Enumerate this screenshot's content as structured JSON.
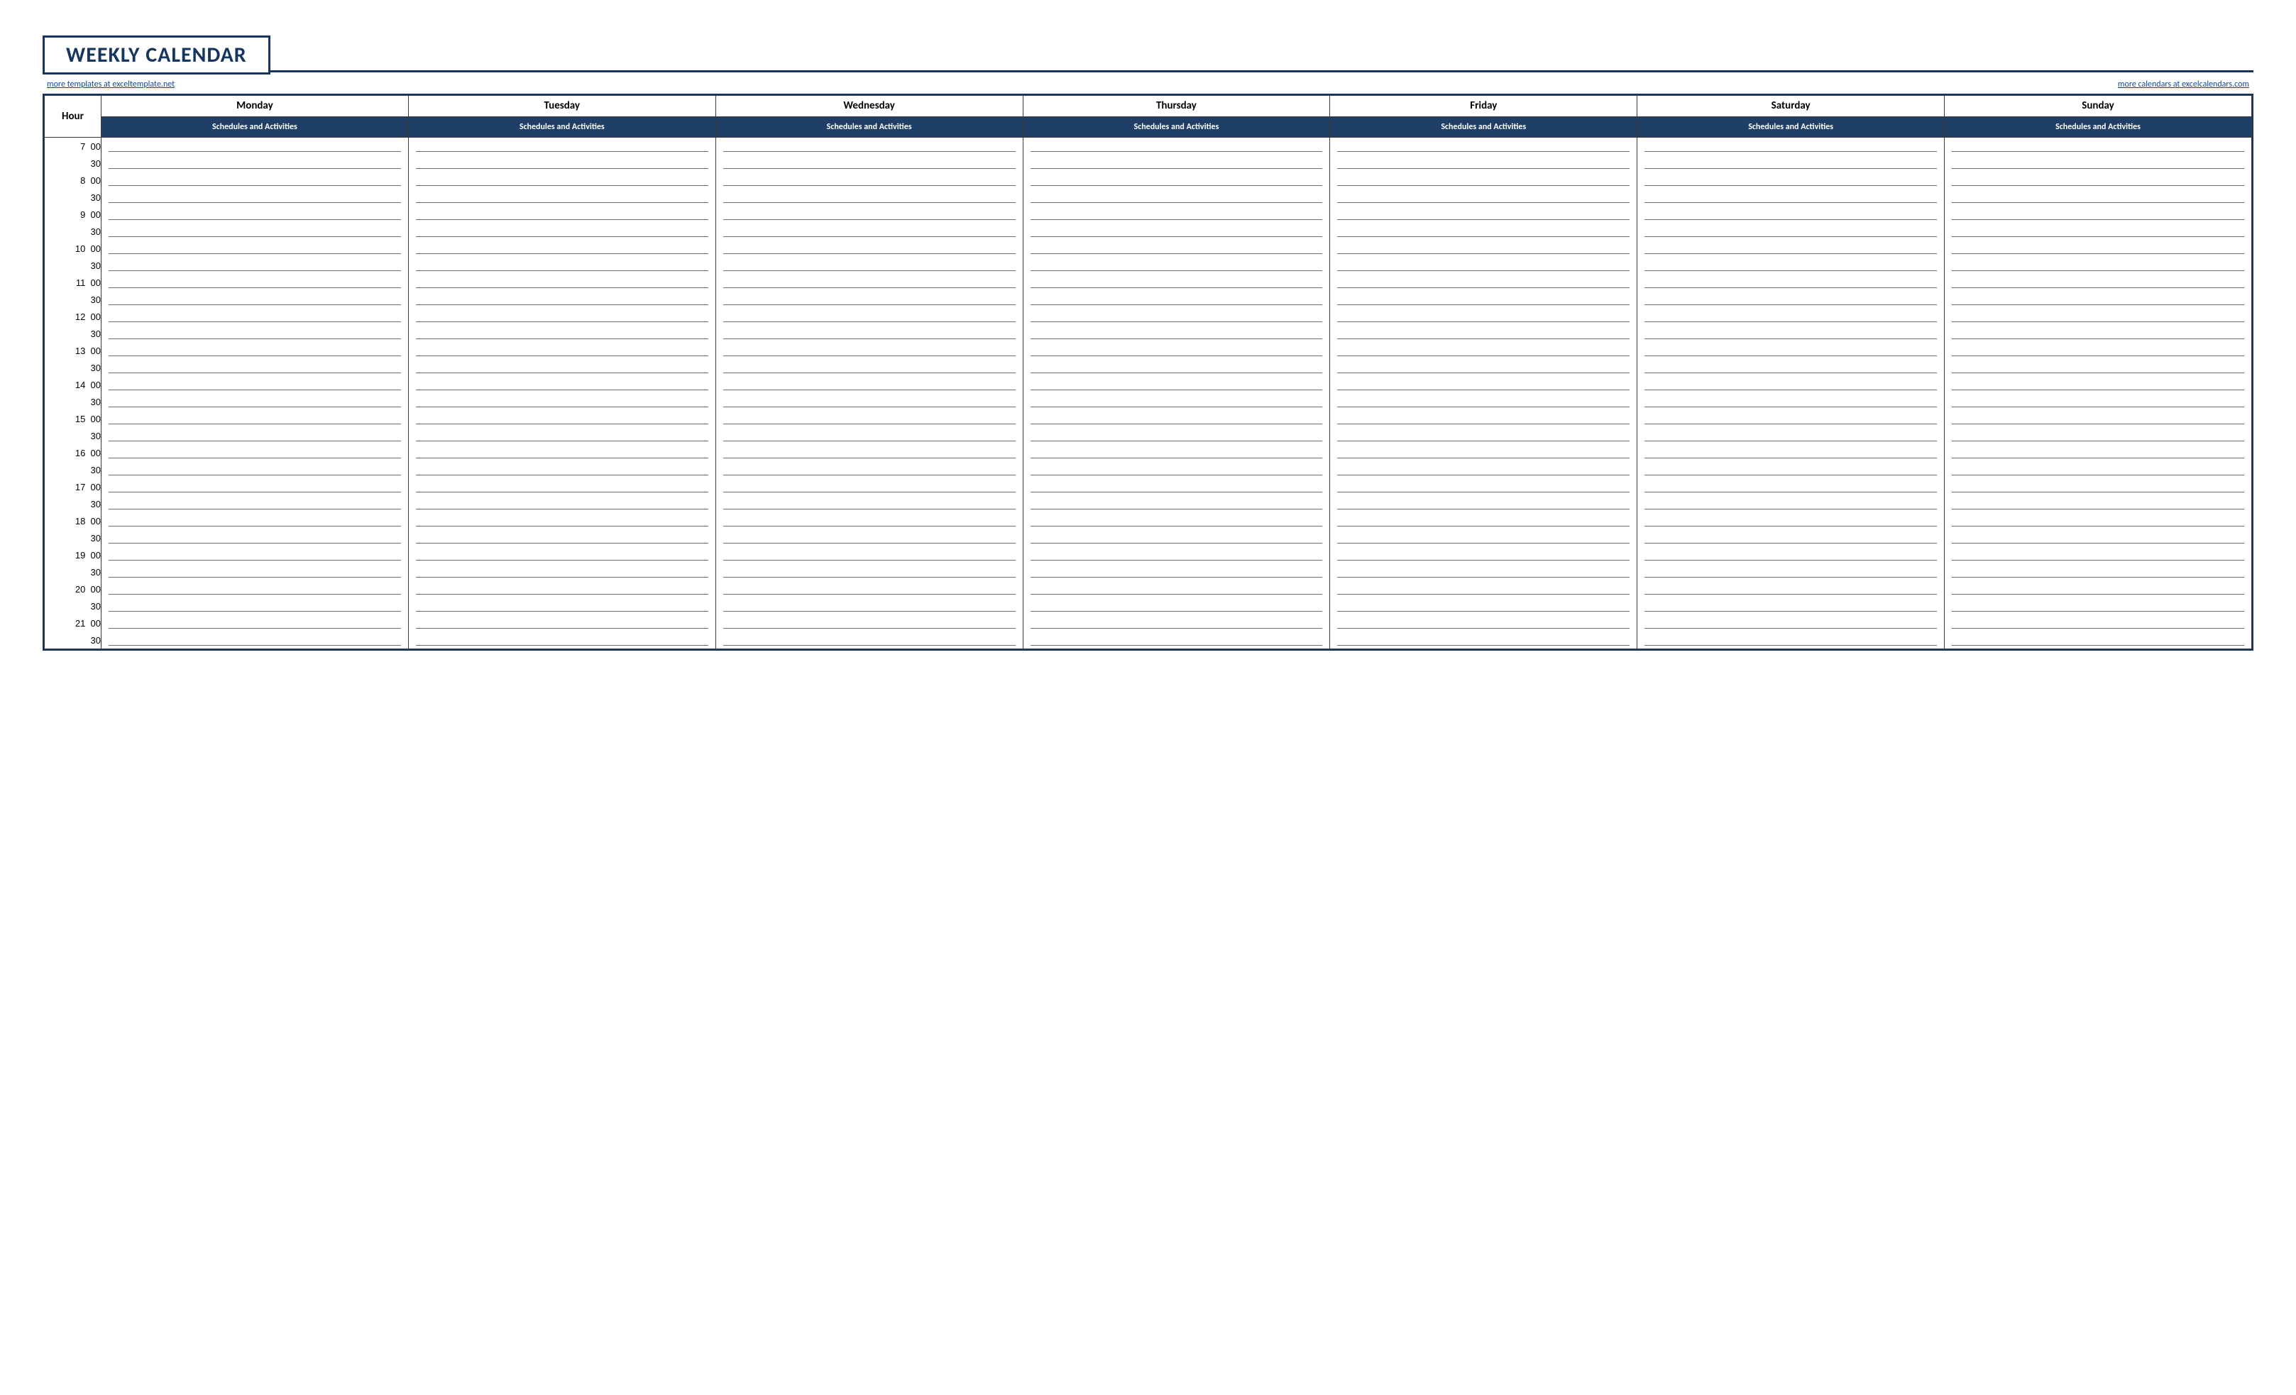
{
  "title": "WEEKLY CALENDAR",
  "links": {
    "left": "more templates at exceltemplate.net",
    "right": "more calendars at excelcalendars.com"
  },
  "hourLabel": "Hour",
  "days": [
    "Monday",
    "Tuesday",
    "Wednesday",
    "Thursday",
    "Friday",
    "Saturday",
    "Sunday"
  ],
  "subHeader": "Schedules and Activities",
  "startHour": 7,
  "endHour": 21,
  "minuteLabels": [
    "00",
    "30"
  ]
}
